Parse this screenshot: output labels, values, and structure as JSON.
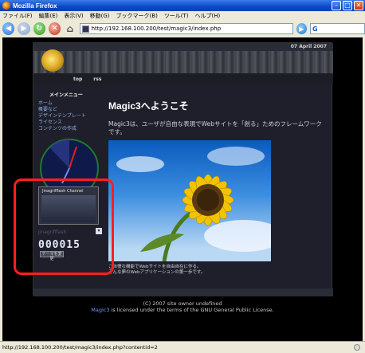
{
  "window": {
    "title": "Mozilla Firefox"
  },
  "menu": [
    "ファイル(F)",
    "編集(E)",
    "表示(V)",
    "移動(G)",
    "ブックマーク(B)",
    "ツール(T)",
    "ヘルプ(H)"
  ],
  "toolbar": {
    "url": "http://192.168.100.200/test/magic3/index.php"
  },
  "site": {
    "date": "07 April 2007",
    "nav": [
      "top",
      "rss"
    ],
    "sidebar": {
      "title": "メインメニュー",
      "links": [
        "ホーム",
        "概要など",
        "デザインテンプレート",
        "ライセンス",
        "コンテンツの作成"
      ],
      "theme_name": "Jinagrifflash",
      "thumb_title": "Jinagrifflash Channel",
      "counter": "000015",
      "btn_small": "切替",
      "btn_apply": "テーマを変更"
    },
    "main": {
      "heading": "Magic3へようこそ",
      "intro": "Magic3は、ユーザが自由な表現でWebサイトを「創る」ためのフレームワークです。",
      "caption_line1": "ご自慢な機能でWebサイトを自由自在に作る。",
      "caption_line2": "そんな夢のWebアプリケーションの第一歩です。"
    },
    "footer": {
      "line1": "(C) 2007 site owner undefined",
      "line2_link": "Magic3",
      "line2_rest": " is licensed under the terms of the GNU General Public License."
    }
  },
  "status": {
    "text": "http://192.168.100.200/test/magic3/index.php?contentid=2"
  },
  "colors": {
    "accent": "#ff1e1e",
    "titlebar": "#0a49c8",
    "page_bg": "#000000"
  }
}
